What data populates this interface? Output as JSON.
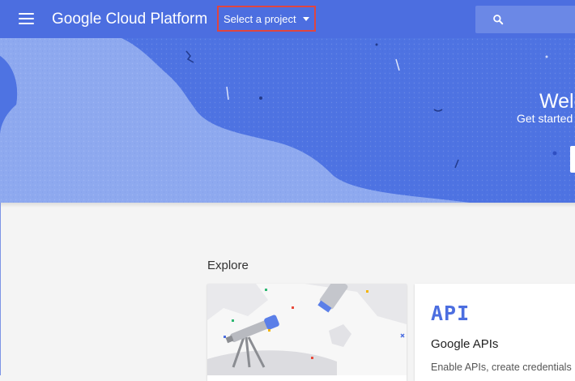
{
  "colors": {
    "app_bar": "#4c6ee0",
    "search_bg": "#6b88e6",
    "hero_bg": "#4e73e2",
    "hero_wave": "#8ea9ef",
    "highlight_border": "#e0453f",
    "page_bg": "#f4f4f4"
  },
  "header": {
    "menu_icon": "hamburger-menu-icon",
    "brand": "Google Cloud Platform",
    "project_picker": {
      "label": "Select a project",
      "icon": "caret-down-icon"
    },
    "search": {
      "icon": "search-icon",
      "placeholder": ""
    }
  },
  "hero": {
    "title": "Welc",
    "subtitle": "Get started"
  },
  "explore": {
    "heading": "Explore",
    "cards": [
      {
        "illustration": "telescope-illustration"
      },
      {
        "icon_text": "API",
        "title": "Google APIs",
        "description": "Enable APIs, create credentials"
      }
    ]
  }
}
